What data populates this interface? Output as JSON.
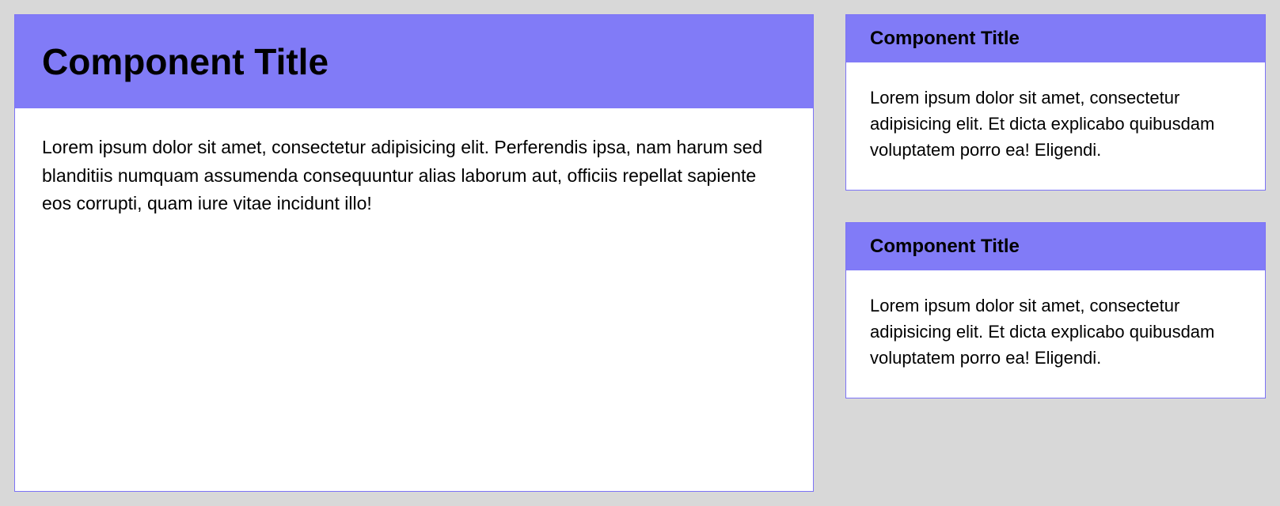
{
  "main": {
    "title": "Component Title",
    "body": "Lorem ipsum dolor sit amet, consectetur adipisicing elit. Perferendis ipsa, nam harum sed blanditiis numquam assumenda consequuntur alias laborum aut, officiis repellat sapiente eos corrupti, quam iure vitae incidunt illo!"
  },
  "side": [
    {
      "title": "Component Title",
      "body": "Lorem ipsum dolor sit amet, consectetur adipisicing elit. Et dicta explicabo quibusdam voluptatem porro ea! Eligendi."
    },
    {
      "title": "Component Title",
      "body": "Lorem ipsum dolor sit amet, consectetur adipisicing elit. Et dicta explicabo quibusdam voluptatem porro ea! Eligendi."
    }
  ]
}
